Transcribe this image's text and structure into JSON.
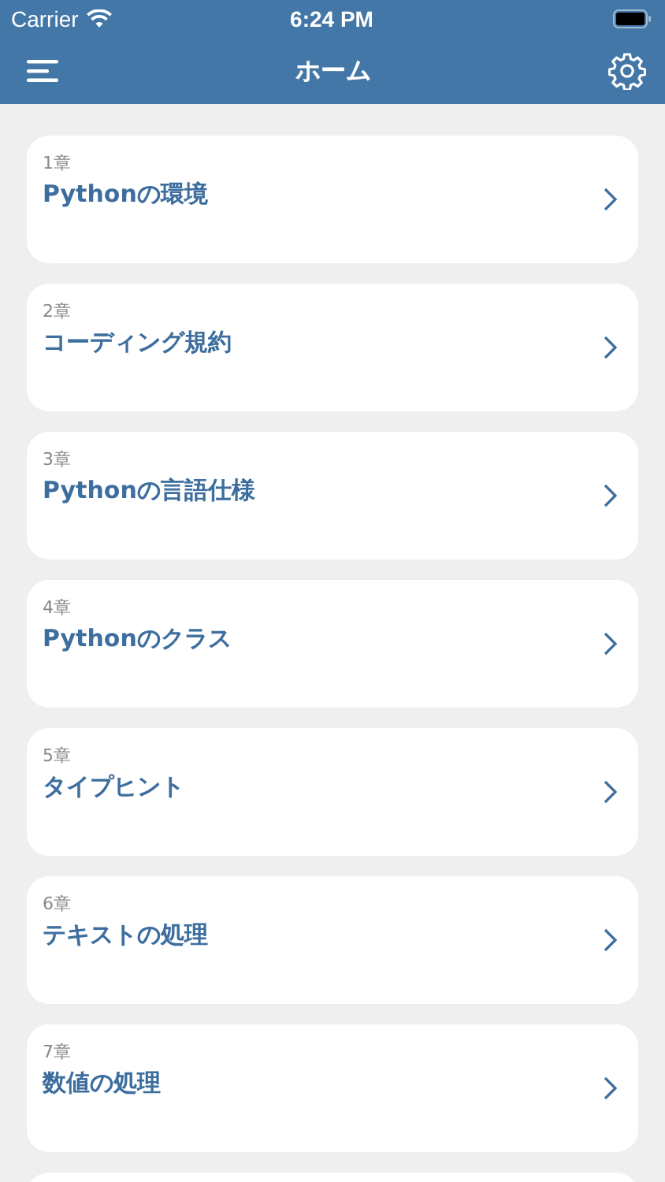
{
  "status_bar": {
    "carrier": "Carrier",
    "time": "6:24 PM"
  },
  "nav_bar": {
    "title": "ホーム"
  },
  "chapters": [
    {
      "number": "1章",
      "title": "Pythonの環境"
    },
    {
      "number": "2章",
      "title": "コーディング規約"
    },
    {
      "number": "3章",
      "title": "Pythonの言語仕様"
    },
    {
      "number": "4章",
      "title": "Pythonのクラス"
    },
    {
      "number": "5章",
      "title": "タイプヒント"
    },
    {
      "number": "6章",
      "title": "テキストの処理"
    },
    {
      "number": "7章",
      "title": "数値の処理"
    }
  ]
}
